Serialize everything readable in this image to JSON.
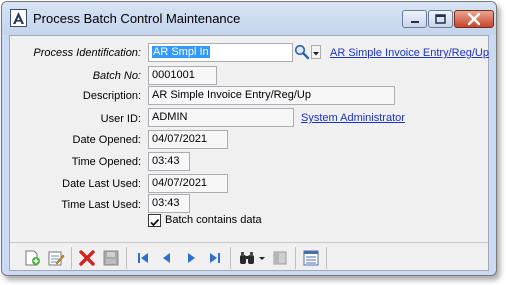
{
  "window": {
    "title": "Process Batch Control Maintenance",
    "accent": "#c9daf2",
    "close_color": "#c8452c"
  },
  "form": {
    "process_id": {
      "label": "Process Identification:",
      "value": "AR Smpl In",
      "link": "AR Simple Invoice Entry/Reg/Up"
    },
    "batch_no": {
      "label": "Batch No:",
      "value": "0001001"
    },
    "description": {
      "label": "Description:",
      "value": "AR Simple Invoice Entry/Reg/Up"
    },
    "user_id": {
      "label": "User ID:",
      "value": "ADMIN",
      "link": "System Administrator"
    },
    "date_opened": {
      "label": "Date Opened:",
      "value": "04/07/2021"
    },
    "time_opened": {
      "label": "Time Opened:",
      "value": "03:43"
    },
    "date_last_used": {
      "label": "Date Last Used:",
      "value": "04/07/2021"
    },
    "time_last_used": {
      "label": "Time Last Used:",
      "value": "03:43"
    },
    "batch_contains_data": {
      "label": "Batch contains data",
      "checked": true
    }
  },
  "toolbar": {
    "icons": [
      "new-record-icon",
      "edit-record-icon",
      "delete-icon",
      "save-icon",
      "first-record-icon",
      "previous-record-icon",
      "next-record-icon",
      "last-record-icon",
      "find-icon",
      "find-dropdown-icon",
      "panel-icon",
      "list-icon"
    ]
  }
}
